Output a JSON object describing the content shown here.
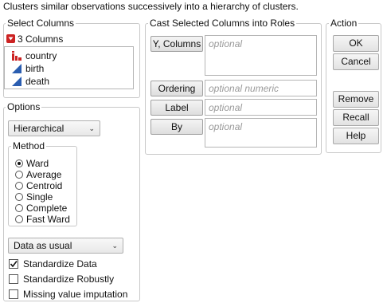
{
  "header": {
    "description": "Clusters similar observations successively into a hierarchy of clusters."
  },
  "select_columns": {
    "title": "Select Columns",
    "count_label": "3 Columns",
    "columns": [
      {
        "name": "country",
        "icon": "nominal-bar-icon"
      },
      {
        "name": "birth",
        "icon": "continuous-triangle-icon"
      },
      {
        "name": "death",
        "icon": "continuous-triangle-icon"
      }
    ]
  },
  "options": {
    "title": "Options",
    "type_select": "Hierarchical",
    "method": {
      "title": "Method",
      "items": [
        "Ward",
        "Average",
        "Centroid",
        "Single",
        "Complete",
        "Fast Ward"
      ],
      "selected": "Ward"
    },
    "data_select": "Data as usual",
    "checks": [
      {
        "label": "Standardize Data",
        "checked": true
      },
      {
        "label": "Standardize Robustly",
        "checked": false
      },
      {
        "label": "Missing value imputation",
        "checked": false
      }
    ]
  },
  "roles": {
    "title": "Cast Selected Columns into Roles",
    "items": [
      {
        "button": "Y, Columns",
        "placeholder": "optional"
      },
      {
        "button": "Ordering",
        "placeholder": "optional numeric"
      },
      {
        "button": "Label",
        "placeholder": "optional"
      },
      {
        "button": "By",
        "placeholder": "optional"
      }
    ]
  },
  "action": {
    "title": "Action",
    "ok": "OK",
    "cancel": "Cancel",
    "remove": "Remove",
    "recall": "Recall",
    "help": "Help"
  },
  "colors": {
    "accent_red": "#cc2222",
    "continuous_blue": "#2a5db0"
  }
}
